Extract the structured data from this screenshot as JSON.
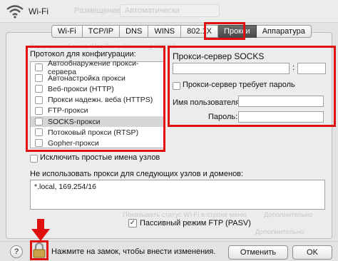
{
  "window": {
    "title": "Wi-Fi",
    "ghost_label": "Размещение",
    "ghost_value": "Автоматически"
  },
  "tabs": [
    {
      "label": "Wi-Fi",
      "active": false
    },
    {
      "label": "TCP/IP",
      "active": false
    },
    {
      "label": "DNS",
      "active": false
    },
    {
      "label": "WINS",
      "active": false
    },
    {
      "label": "802.1X",
      "active": false
    },
    {
      "label": "Прокси",
      "active": true
    },
    {
      "label": "Аппаратура",
      "active": false
    }
  ],
  "protocols": {
    "title": "Протокол для конфигурации:",
    "items": [
      {
        "label": "Автообнаружение прокси-сервера",
        "checked": false,
        "selected": false
      },
      {
        "label": "Автонастройка прокси",
        "checked": false,
        "selected": false
      },
      {
        "label": "Веб-прокси (HTTP)",
        "checked": false,
        "selected": false
      },
      {
        "label": "Прокси надежн. веба (HTTPS)",
        "checked": false,
        "selected": false
      },
      {
        "label": "FTP-прокси",
        "checked": false,
        "selected": false
      },
      {
        "label": "SOCKS-прокси",
        "checked": false,
        "selected": true
      },
      {
        "label": "Потоковый прокси (RTSP)",
        "checked": false,
        "selected": false
      },
      {
        "label": "Gopher-прокси",
        "checked": false,
        "selected": false
      }
    ]
  },
  "socks": {
    "title": "Прокси-сервер SOCKS",
    "host_value": "",
    "port_colon": ":",
    "port_value": "",
    "auth_label": "Прокси-сервер требует пароль",
    "user_label": "Имя пользователя:",
    "user_value": "",
    "pass_label": "Пароль:",
    "pass_value": ""
  },
  "exclusions": {
    "simple_hosts_label": "Исключить простые имена узлов",
    "bypass_label": "Не использовать прокси для следующих узлов и доменов:",
    "bypass_value": "*.local, 169.254/16"
  },
  "background": {
    "ghost_strip": "Proxy server        Secure Web Proxy        Streaming        SOCKS",
    "ghost_status": "Показывать статус Wi-Fi в строке меню",
    "ghost_right": "Дополнительно",
    "ghost_right2": "Дополнительно",
    "pasv_label": "Пассивный режим FTP (PASV)",
    "pasv_checked": "✓"
  },
  "footer": {
    "help_label": "?",
    "lock_text": "Нажмите на замок, чтобы внести изменения.",
    "cancel_label": "Отменить",
    "ok_label": "OK"
  },
  "colors": {
    "highlight": "#e01010",
    "active_tab": "#4a4a4a"
  }
}
